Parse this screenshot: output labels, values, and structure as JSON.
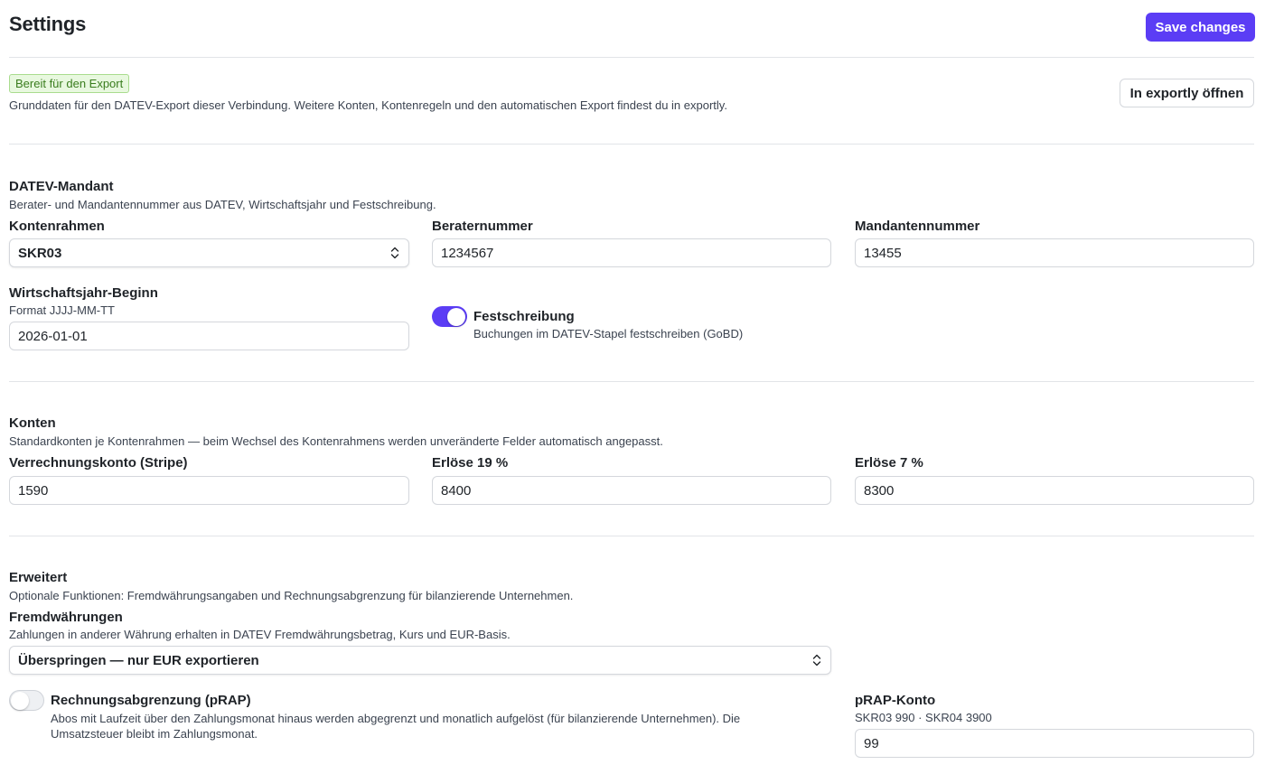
{
  "header": {
    "title": "Settings",
    "save_label": "Save changes"
  },
  "status": {
    "badge": "Bereit für den Export",
    "description": "Grunddaten für den DATEV-Export dieser Verbindung. Weitere Konten, Kontenregeln und den automatischen Export findest du in exportly.",
    "open_label": "In exportly öffnen"
  },
  "mandant": {
    "title": "DATEV-Mandant",
    "description": "Berater- und Mandantennummer aus DATEV, Wirtschaftsjahr und Festschreibung.",
    "kontenrahmen_label": "Kontenrahmen",
    "kontenrahmen_value": "SKR03",
    "berater_label": "Beraternummer",
    "berater_value": "1234567",
    "mandanten_label": "Mandantennummer",
    "mandanten_value": "13455",
    "wj_label": "Wirtschaftsjahr-Beginn",
    "wj_hint": "Format JJJJ-MM-TT",
    "wj_value": "2026-01-01",
    "fest_label": "Festschreibung",
    "fest_hint": "Buchungen im DATEV-Stapel festschreiben (GoBD)",
    "fest_enabled": true
  },
  "konten": {
    "title": "Konten",
    "description": "Standardkonten je Kontenrahmen — beim Wechsel des Kontenrahmens werden unveränderte Felder automatisch angepasst.",
    "verrechnung_label": "Verrechnungskonto (Stripe)",
    "verrechnung_value": "1590",
    "erloese19_label": "Erlöse 19 %",
    "erloese19_value": "8400",
    "erloese7_label": "Erlöse 7 %",
    "erloese7_value": "8300"
  },
  "erweitert": {
    "title": "Erweitert",
    "description": "Optionale Funktionen: Fremdwährungsangaben und Rechnungsabgrenzung für bilanzierende Unternehmen.",
    "fw_label": "Fremdwährungen",
    "fw_hint": "Zahlungen in anderer Währung erhalten in DATEV Fremdwährungsbetrag, Kurs und EUR-Basis.",
    "fw_value": "Überspringen — nur EUR exportieren",
    "prap_label": "Rechnungsabgrenzung (pRAP)",
    "prap_hint_line1": "Abos mit Laufzeit über den Zahlungsmonat hinaus werden abgegrenzt und monatlich aufgelöst (für bilanzierende Unternehmen). Die",
    "prap_hint_line2": "Umsatzsteuer bleibt im Zahlungsmonat.",
    "prap_enabled": false,
    "prap_konto_label": "pRAP-Konto",
    "prap_konto_hint": "SKR03 990 · SKR04 3900",
    "prap_konto_value": "99"
  },
  "colors": {
    "accent": "#5b3df5",
    "badge_bg": "#e8f8df",
    "badge_text": "#3a7d1e",
    "border": "#d4d7dc",
    "divider": "#e2e4e8"
  }
}
